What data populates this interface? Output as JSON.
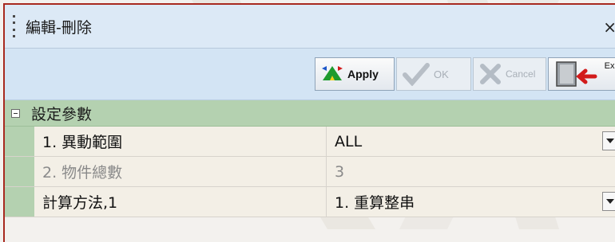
{
  "window": {
    "title": "編輯-刪除",
    "close_glyph": "×"
  },
  "toolbar": {
    "apply_label": "Apply",
    "ok_label": "OK",
    "cancel_label": "Cancel",
    "exit_label": "Exit",
    "apply_icon": "triangle-arrows-icon",
    "ok_icon": "checkmark-icon",
    "cancel_icon": "x-mark-icon",
    "exit_icon": "exit-door-arrow-icon"
  },
  "section": {
    "label": "設定參數",
    "expander_icon": "collapse-minus-icon"
  },
  "rows": [
    {
      "name": "1. 異動範圍",
      "value": "ALL",
      "has_dropdown": true,
      "disabled": false
    },
    {
      "name": "2. 物件總數",
      "value": "3",
      "has_dropdown": false,
      "disabled": true
    },
    {
      "name": "計算方法,1",
      "value": "1. 重算整串",
      "has_dropdown": true,
      "disabled": false
    }
  ],
  "colors": {
    "frame_border": "#a8291f",
    "titlebar_bg": "#dce9f6",
    "section_bg": "#b4d1b0",
    "cell_bg": "#f3efe6"
  }
}
